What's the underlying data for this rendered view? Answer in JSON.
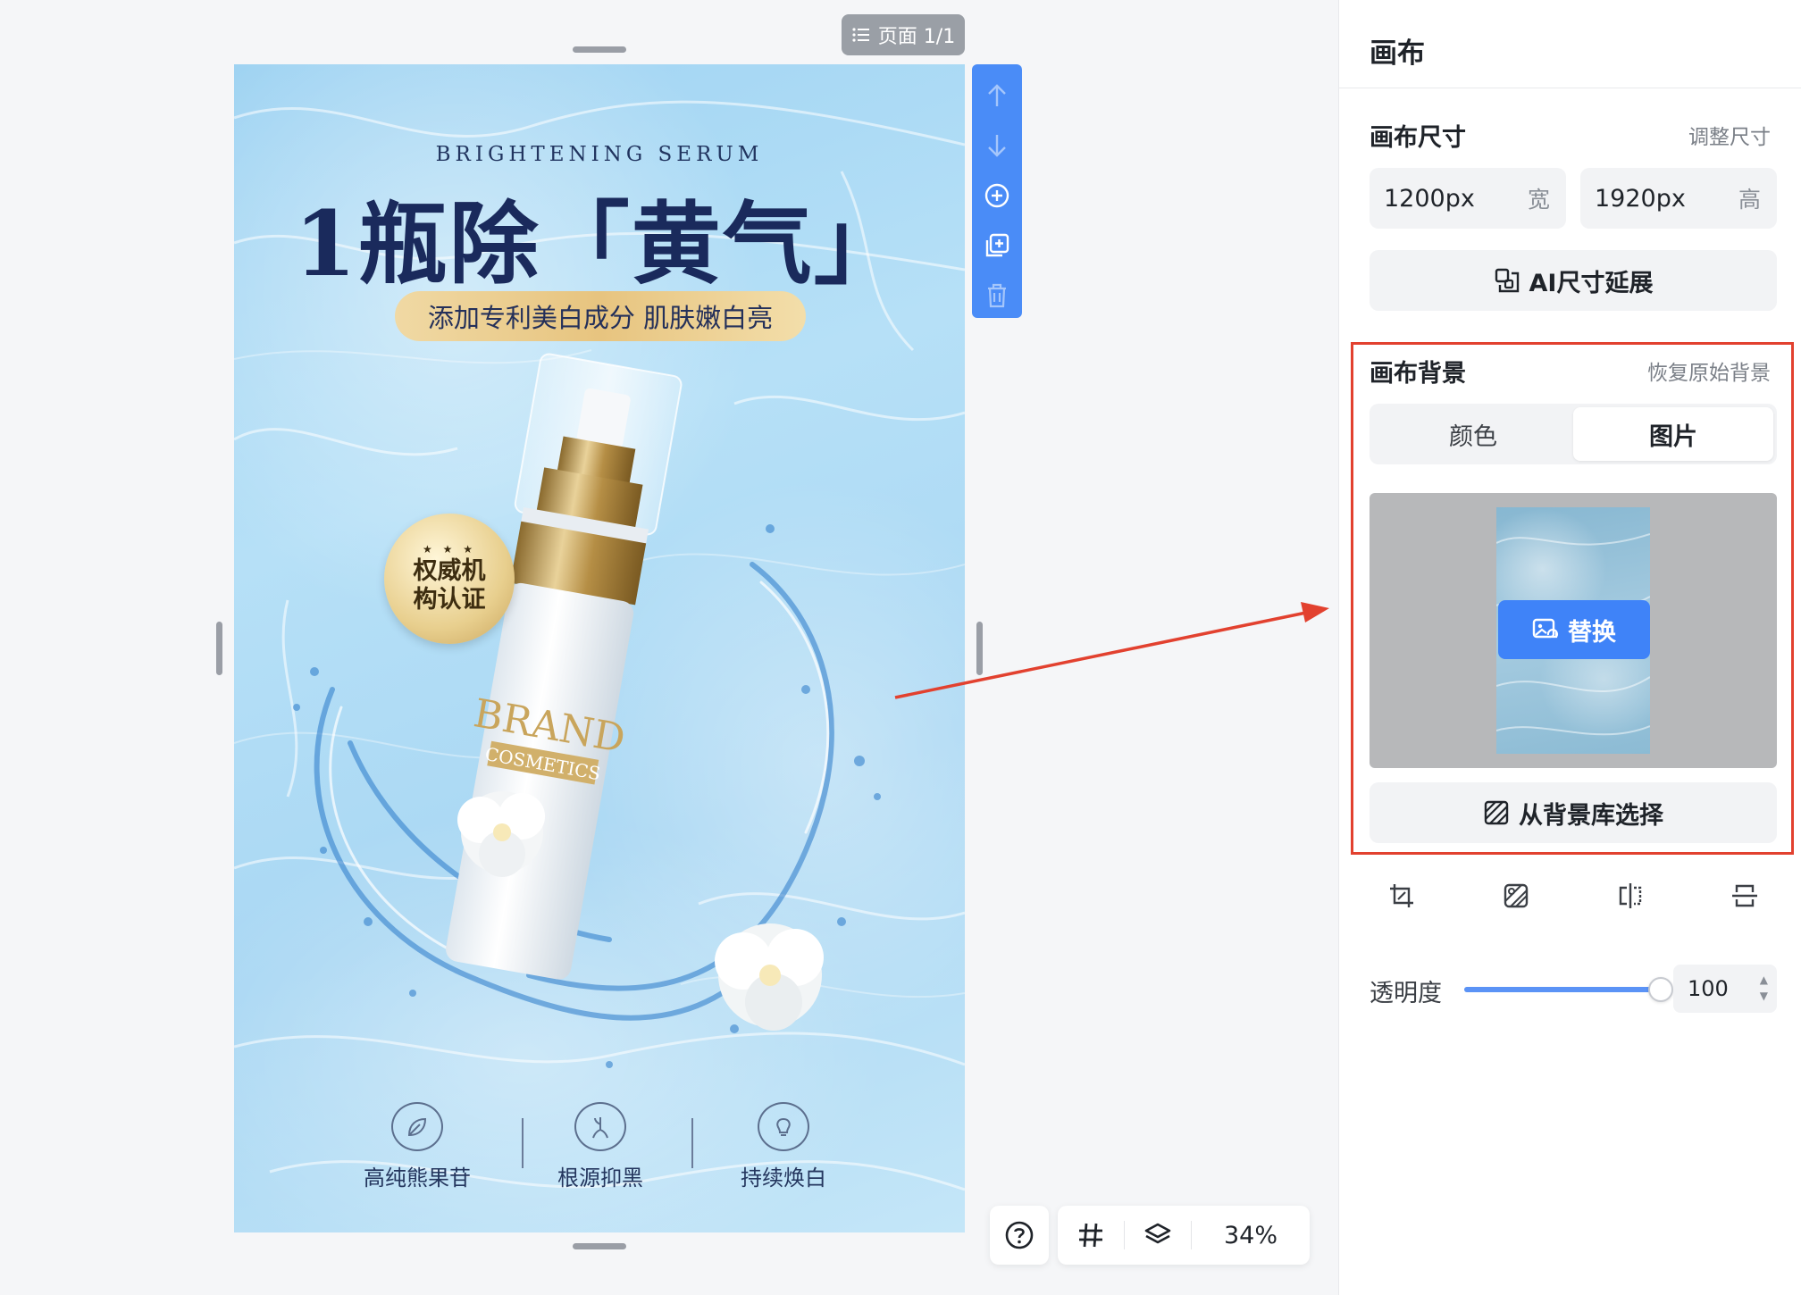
{
  "canvas": {
    "page_indicator": "页面 1/1"
  },
  "poster": {
    "subtitle_en": "BRIGHTENING SERUM",
    "title": "1瓶除「黄气」",
    "tagline": "添加专利美白成分 肌肤嫩白亮",
    "seal_stars": "★ ★ ★",
    "seal_line1": "权威机",
    "seal_line2": "构认证",
    "bottle_brand": "BRAND",
    "bottle_sub": "COSMETICS",
    "features": [
      {
        "label": "高纯熊果苷",
        "icon": "leaf-icon"
      },
      {
        "label": "根源抑黑",
        "icon": "root-icon"
      },
      {
        "label": "持续焕白",
        "icon": "lightbulb-icon"
      }
    ]
  },
  "vertical_toolbar": {
    "items": [
      "arrow-up-icon",
      "arrow-down-icon",
      "add-circle-icon",
      "duplicate-icon",
      "trash-icon"
    ]
  },
  "bottom_controls": {
    "help_icon": "question-icon",
    "grid_icon": "grid-icon",
    "layers_icon": "layers-icon",
    "zoom": "34%"
  },
  "panel": {
    "title": "画布",
    "size_section": {
      "title": "画布尺寸",
      "link": "调整尺寸",
      "width_value": "1200px",
      "width_unit": "宽",
      "height_value": "1920px",
      "height_unit": "高",
      "ai_button": "AI尺寸延展"
    },
    "background_section": {
      "title": "画布背景",
      "link": "恢复原始背景",
      "tabs": [
        "颜色",
        "图片"
      ],
      "active_tab": "图片",
      "replace_button": "替换",
      "library_button": "从背景库选择"
    },
    "image_tools": [
      "crop-icon",
      "pattern-icon",
      "flip-horizontal-icon",
      "flip-vertical-icon"
    ],
    "opacity": {
      "label": "透明度",
      "value": "100",
      "fraction": 1.0
    }
  },
  "colors": {
    "accent": "#3f83f8",
    "annotation": "#e2412f"
  }
}
